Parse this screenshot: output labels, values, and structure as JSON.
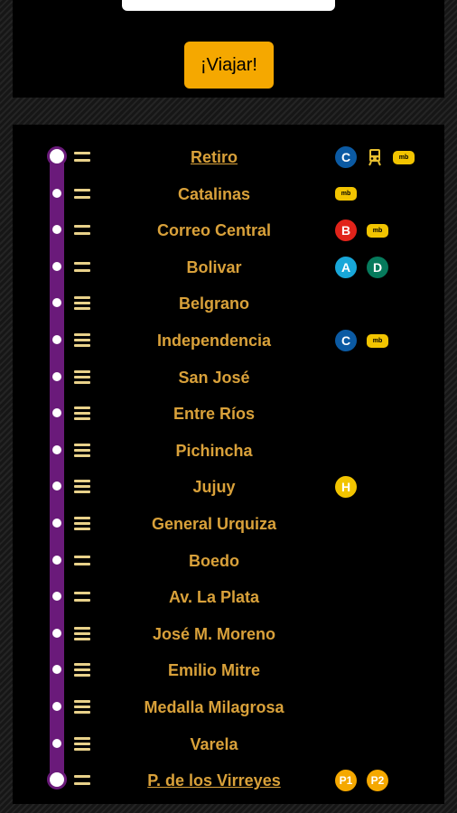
{
  "viajar_label": "¡Viajar!",
  "line_color": "#6a1a7a",
  "stations": [
    {
      "name": "Retiro",
      "badges": [
        {
          "type": "C",
          "label": "C"
        },
        {
          "type": "train",
          "label": ""
        },
        {
          "type": "metrobus",
          "label": "mb"
        }
      ]
    },
    {
      "name": "Catalinas",
      "badges": [
        {
          "type": "metrobus",
          "label": "mb"
        }
      ]
    },
    {
      "name": "Correo Central",
      "badges": [
        {
          "type": "B",
          "label": "B"
        },
        {
          "type": "metrobus",
          "label": "mb"
        }
      ]
    },
    {
      "name": "Bolivar",
      "badges": [
        {
          "type": "A",
          "label": "A"
        },
        {
          "type": "D",
          "label": "D"
        }
      ]
    },
    {
      "name": "Belgrano",
      "badges": []
    },
    {
      "name": "Independencia",
      "badges": [
        {
          "type": "C",
          "label": "C"
        },
        {
          "type": "metrobus",
          "label": "mb"
        }
      ]
    },
    {
      "name": "San José",
      "badges": []
    },
    {
      "name": "Entre Ríos",
      "badges": []
    },
    {
      "name": "Pichincha",
      "badges": []
    },
    {
      "name": "Jujuy",
      "badges": [
        {
          "type": "H",
          "label": "H"
        }
      ]
    },
    {
      "name": "General Urquiza",
      "badges": []
    },
    {
      "name": "Boedo",
      "badges": []
    },
    {
      "name": "Av. La Plata",
      "badges": []
    },
    {
      "name": "José M. Moreno",
      "badges": []
    },
    {
      "name": "Emilio Mitre",
      "badges": []
    },
    {
      "name": "Medalla Milagrosa",
      "badges": []
    },
    {
      "name": "Varela",
      "badges": []
    },
    {
      "name": "P. de los Virreyes",
      "badges": [
        {
          "type": "P",
          "label": "P1"
        },
        {
          "type": "P",
          "label": "P2"
        }
      ]
    }
  ]
}
